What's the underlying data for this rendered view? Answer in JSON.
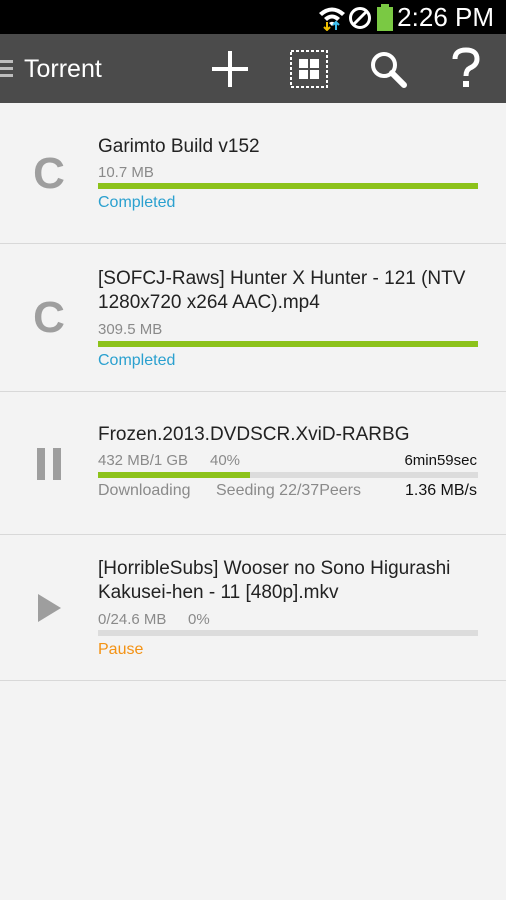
{
  "status_bar": {
    "time": "2:26 PM"
  },
  "action_bar": {
    "title": "Torrent",
    "actions": [
      "add-icon",
      "select-all-icon",
      "search-icon",
      "help-icon"
    ]
  },
  "colors": {
    "progress": "#8cc21a",
    "completed": "#2aa0cf",
    "pause": "#f39214",
    "downloading": "#8a8a8a"
  },
  "torrents": [
    {
      "icon_letter": "C",
      "name": "Garimto Build v152",
      "size": "10.7 MB",
      "progress": 100,
      "status": "Completed"
    },
    {
      "icon_letter": "C",
      "name": "[SOFCJ-Raws] Hunter X Hunter - 121 (NTV 1280x720 x264 AAC).mp4",
      "size": "309.5 MB",
      "progress": 100,
      "status": "Completed"
    },
    {
      "icon": "pause-icon",
      "name": "Frozen.2013.DVDSCR.XviD-RARBG",
      "size": "432 MB/1 GB",
      "percent_label": "40%",
      "eta": "6min59sec",
      "progress": 40,
      "status": "Downloading",
      "seeding": "Seeding 22/37Peers",
      "speed": "1.36 MB/s"
    },
    {
      "icon": "play-icon",
      "name": "[HorribleSubs] Wooser no Sono Higurashi Kakusei-hen - 11 [480p].mkv",
      "size": "0/24.6 MB",
      "percent_label": "0%",
      "progress": 0,
      "status": "Pause"
    }
  ]
}
